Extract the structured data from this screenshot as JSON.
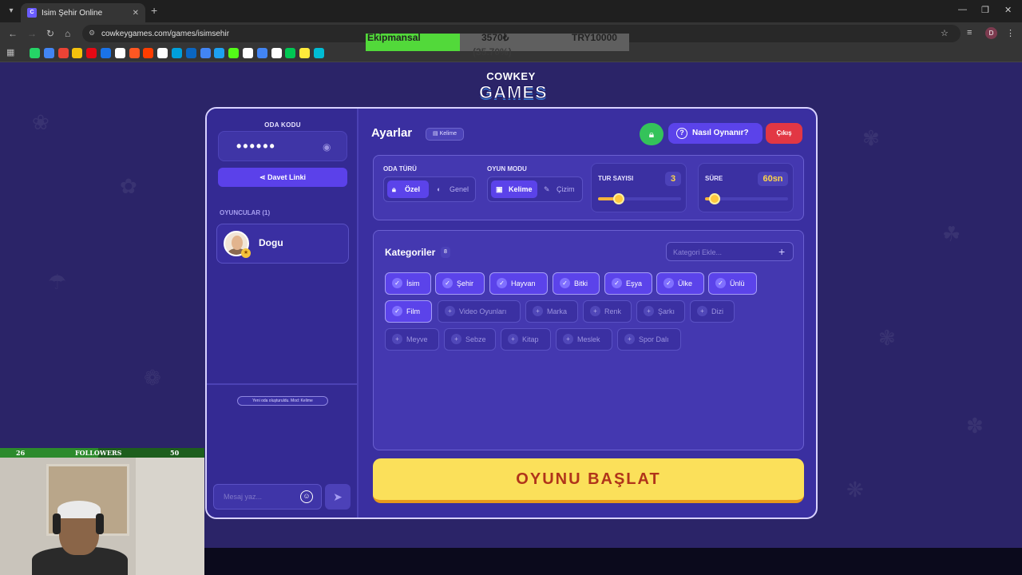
{
  "browser": {
    "tab_title": "İsim Şehir Online",
    "url": "cowkeygames.com/games/isimsehir",
    "profile_initial": "D",
    "bookmark_colors": [
      "#25d366",
      "#4285f4",
      "#ea4335",
      "#f4c20d",
      "#e50914",
      "#1a73e8",
      "#ffffff",
      "#ff5722",
      "#ff3d00",
      "#ffffff",
      "#00a0dc",
      "#0a66c2",
      "#4285f4",
      "#1da1f2",
      "#53fc18",
      "#ffffff",
      "#4285f4",
      "#ffffff",
      "#00c853",
      "#ffeb3b",
      "#00bcd4"
    ]
  },
  "stream_goal": {
    "left_text": "Ekipmansal",
    "mid_text": "3570₺",
    "mid_sub": "(35.70%)",
    "right_text": "TRY10000",
    "progress": 0.357,
    "fill_color": "#52d93a"
  },
  "logo": {
    "line1": "COWKEY",
    "line2": "GAMES"
  },
  "left": {
    "oda_label": "ODA KODU",
    "oda_code": "••••••",
    "eye_icon": "eye-icon",
    "davet_label": "Davet Linki",
    "players_title": "OYUNCULAR (1)",
    "players": [
      {
        "name": "Dogu"
      }
    ],
    "system_message": "Yeni oda oluşturuldu. Mod: Kelime",
    "chat_placeholder": "Mesaj yaz..."
  },
  "header": {
    "title": "Ayarlar",
    "mode_tag": "Kelime",
    "help_label": "Nasıl Oynanır?",
    "exit_label": "Çıkış",
    "lock_color": "#34c35a",
    "exit_color": "#e23744"
  },
  "settings": {
    "room_type_label": "ODA TÜRÜ",
    "room_type_options": [
      "Özel",
      "Genel"
    ],
    "room_type_selected": "Özel",
    "game_mode_label": "OYUN MODU",
    "game_mode_options": [
      "Kelime",
      "Çizim"
    ],
    "game_mode_selected": "Kelime",
    "rounds_label": "TUR SAYISI",
    "rounds_value": "3",
    "rounds_level": 0.25,
    "time_label": "SÜRE",
    "time_value": "60sn",
    "time_level": 0.12
  },
  "categories": {
    "title": "Kategoriler",
    "count": "8",
    "add_placeholder": "Kategori Ekle...",
    "row1": [
      {
        "label": "İsim",
        "on": true
      },
      {
        "label": "Şehir",
        "on": true
      },
      {
        "label": "Hayvan",
        "on": true
      },
      {
        "label": "Bitki",
        "on": true
      },
      {
        "label": "Eşya",
        "on": true
      },
      {
        "label": "Ülke",
        "on": true
      },
      {
        "label": "Ünlü",
        "on": true
      }
    ],
    "row2": [
      {
        "label": "Film",
        "on": true
      },
      {
        "label": "Video Oyunları",
        "on": false
      },
      {
        "label": "Marka",
        "on": false
      },
      {
        "label": "Renk",
        "on": false
      },
      {
        "label": "Şarkı",
        "on": false
      },
      {
        "label": "Dizi",
        "on": false
      }
    ],
    "row3": [
      {
        "label": "Meyve",
        "on": false
      },
      {
        "label": "Sebze",
        "on": false
      },
      {
        "label": "Kitap",
        "on": false
      },
      {
        "label": "Meslek",
        "on": false
      },
      {
        "label": "Spor Dalı",
        "on": false
      }
    ]
  },
  "start_label": "OYUNU BAŞLAT",
  "followers_overlay": {
    "left": "26",
    "label": "FOLLOWERS",
    "right": "50"
  }
}
